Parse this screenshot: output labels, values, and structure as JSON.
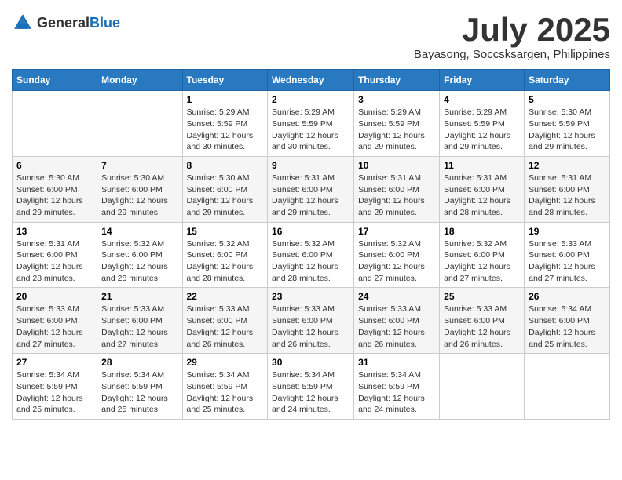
{
  "logo": {
    "general": "General",
    "blue": "Blue"
  },
  "title": "July 2025",
  "location": "Bayasong, Soccsksargen, Philippines",
  "days_of_week": [
    "Sunday",
    "Monday",
    "Tuesday",
    "Wednesday",
    "Thursday",
    "Friday",
    "Saturday"
  ],
  "weeks": [
    [
      {
        "day": "",
        "info": ""
      },
      {
        "day": "",
        "info": ""
      },
      {
        "day": "1",
        "sunrise": "5:29 AM",
        "sunset": "5:59 PM",
        "daylight": "12 hours and 30 minutes."
      },
      {
        "day": "2",
        "sunrise": "5:29 AM",
        "sunset": "5:59 PM",
        "daylight": "12 hours and 30 minutes."
      },
      {
        "day": "3",
        "sunrise": "5:29 AM",
        "sunset": "5:59 PM",
        "daylight": "12 hours and 29 minutes."
      },
      {
        "day": "4",
        "sunrise": "5:29 AM",
        "sunset": "5:59 PM",
        "daylight": "12 hours and 29 minutes."
      },
      {
        "day": "5",
        "sunrise": "5:30 AM",
        "sunset": "5:59 PM",
        "daylight": "12 hours and 29 minutes."
      }
    ],
    [
      {
        "day": "6",
        "sunrise": "5:30 AM",
        "sunset": "6:00 PM",
        "daylight": "12 hours and 29 minutes."
      },
      {
        "day": "7",
        "sunrise": "5:30 AM",
        "sunset": "6:00 PM",
        "daylight": "12 hours and 29 minutes."
      },
      {
        "day": "8",
        "sunrise": "5:30 AM",
        "sunset": "6:00 PM",
        "daylight": "12 hours and 29 minutes."
      },
      {
        "day": "9",
        "sunrise": "5:31 AM",
        "sunset": "6:00 PM",
        "daylight": "12 hours and 29 minutes."
      },
      {
        "day": "10",
        "sunrise": "5:31 AM",
        "sunset": "6:00 PM",
        "daylight": "12 hours and 29 minutes."
      },
      {
        "day": "11",
        "sunrise": "5:31 AM",
        "sunset": "6:00 PM",
        "daylight": "12 hours and 28 minutes."
      },
      {
        "day": "12",
        "sunrise": "5:31 AM",
        "sunset": "6:00 PM",
        "daylight": "12 hours and 28 minutes."
      }
    ],
    [
      {
        "day": "13",
        "sunrise": "5:31 AM",
        "sunset": "6:00 PM",
        "daylight": "12 hours and 28 minutes."
      },
      {
        "day": "14",
        "sunrise": "5:32 AM",
        "sunset": "6:00 PM",
        "daylight": "12 hours and 28 minutes."
      },
      {
        "day": "15",
        "sunrise": "5:32 AM",
        "sunset": "6:00 PM",
        "daylight": "12 hours and 28 minutes."
      },
      {
        "day": "16",
        "sunrise": "5:32 AM",
        "sunset": "6:00 PM",
        "daylight": "12 hours and 28 minutes."
      },
      {
        "day": "17",
        "sunrise": "5:32 AM",
        "sunset": "6:00 PM",
        "daylight": "12 hours and 27 minutes."
      },
      {
        "day": "18",
        "sunrise": "5:32 AM",
        "sunset": "6:00 PM",
        "daylight": "12 hours and 27 minutes."
      },
      {
        "day": "19",
        "sunrise": "5:33 AM",
        "sunset": "6:00 PM",
        "daylight": "12 hours and 27 minutes."
      }
    ],
    [
      {
        "day": "20",
        "sunrise": "5:33 AM",
        "sunset": "6:00 PM",
        "daylight": "12 hours and 27 minutes."
      },
      {
        "day": "21",
        "sunrise": "5:33 AM",
        "sunset": "6:00 PM",
        "daylight": "12 hours and 27 minutes."
      },
      {
        "day": "22",
        "sunrise": "5:33 AM",
        "sunset": "6:00 PM",
        "daylight": "12 hours and 26 minutes."
      },
      {
        "day": "23",
        "sunrise": "5:33 AM",
        "sunset": "6:00 PM",
        "daylight": "12 hours and 26 minutes."
      },
      {
        "day": "24",
        "sunrise": "5:33 AM",
        "sunset": "6:00 PM",
        "daylight": "12 hours and 26 minutes."
      },
      {
        "day": "25",
        "sunrise": "5:33 AM",
        "sunset": "6:00 PM",
        "daylight": "12 hours and 26 minutes."
      },
      {
        "day": "26",
        "sunrise": "5:34 AM",
        "sunset": "6:00 PM",
        "daylight": "12 hours and 25 minutes."
      }
    ],
    [
      {
        "day": "27",
        "sunrise": "5:34 AM",
        "sunset": "5:59 PM",
        "daylight": "12 hours and 25 minutes."
      },
      {
        "day": "28",
        "sunrise": "5:34 AM",
        "sunset": "5:59 PM",
        "daylight": "12 hours and 25 minutes."
      },
      {
        "day": "29",
        "sunrise": "5:34 AM",
        "sunset": "5:59 PM",
        "daylight": "12 hours and 25 minutes."
      },
      {
        "day": "30",
        "sunrise": "5:34 AM",
        "sunset": "5:59 PM",
        "daylight": "12 hours and 24 minutes."
      },
      {
        "day": "31",
        "sunrise": "5:34 AM",
        "sunset": "5:59 PM",
        "daylight": "12 hours and 24 minutes."
      },
      {
        "day": "",
        "info": ""
      },
      {
        "day": "",
        "info": ""
      }
    ]
  ],
  "labels": {
    "sunrise_prefix": "Sunrise: ",
    "sunset_prefix": "Sunset: ",
    "daylight_prefix": "Daylight: "
  }
}
